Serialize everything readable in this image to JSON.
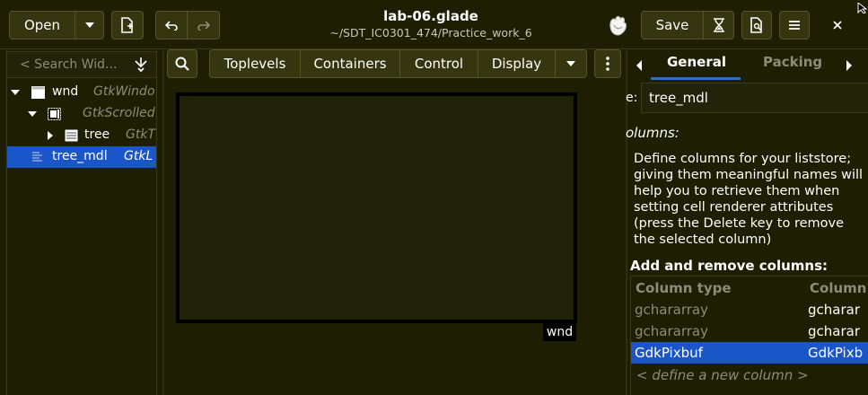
{
  "header": {
    "title": "lab-06.glade",
    "subtitle": "~/SDT_IC0301_474/Practice_work_6",
    "open_label": "Open",
    "save_label": "Save"
  },
  "widget_search": {
    "placeholder": "< Search Wid..."
  },
  "widget_tree": [
    {
      "name": "wnd",
      "type": "GtkWindo",
      "icon": "window-icon"
    },
    {
      "name": "",
      "type": "GtkScrolled",
      "icon": "scrolled-window-icon"
    },
    {
      "name": "tree",
      "type": "GtkT",
      "icon": "treeview-icon"
    },
    {
      "name": "tree_mdl",
      "type": "GtkL",
      "icon": "liststore-icon",
      "selected": true
    }
  ],
  "palette": {
    "groups": [
      "Toplevels",
      "Containers",
      "Control",
      "Display"
    ]
  },
  "canvas": {
    "window_label": "wnd"
  },
  "editor": {
    "tabs": [
      "General",
      "Packing"
    ],
    "active_tab": "General",
    "name_label": "e:",
    "name_value": "tree_mdl",
    "columns_label": "olumns:",
    "description_lines": [
      "Define columns for your liststore;",
      "giving them meaningful names will",
      "help you to retrieve them when",
      "setting cell renderer attributes",
      "(press the Delete key to remove",
      "the selected column)"
    ],
    "add_remove_label": "Add and remove columns:",
    "column_headers": [
      "Column type",
      "Column"
    ],
    "columns": [
      {
        "type": "gchararray",
        "name": "gcharar"
      },
      {
        "type": "gchararray",
        "name": "gcharar"
      },
      {
        "type": "GdkPixbuf",
        "name": "GdkPixb",
        "selected": true
      }
    ],
    "define_new": "< define a new column >"
  },
  "colors": {
    "background": "#1e1e02",
    "selection": "#1a56c8",
    "accent_underline": "#2a6fd6"
  }
}
